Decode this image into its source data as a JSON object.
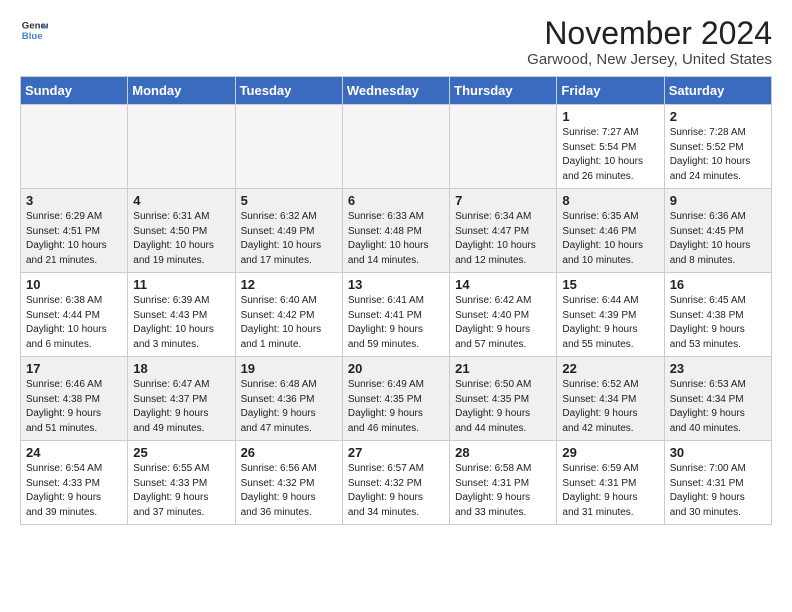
{
  "logo": {
    "line1": "General",
    "line2": "Blue"
  },
  "title": "November 2024",
  "location": "Garwood, New Jersey, United States",
  "weekdays": [
    "Sunday",
    "Monday",
    "Tuesday",
    "Wednesday",
    "Thursday",
    "Friday",
    "Saturday"
  ],
  "weeks": [
    [
      {
        "day": "",
        "info": ""
      },
      {
        "day": "",
        "info": ""
      },
      {
        "day": "",
        "info": ""
      },
      {
        "day": "",
        "info": ""
      },
      {
        "day": "",
        "info": ""
      },
      {
        "day": "1",
        "info": "Sunrise: 7:27 AM\nSunset: 5:54 PM\nDaylight: 10 hours\nand 26 minutes."
      },
      {
        "day": "2",
        "info": "Sunrise: 7:28 AM\nSunset: 5:52 PM\nDaylight: 10 hours\nand 24 minutes."
      }
    ],
    [
      {
        "day": "3",
        "info": "Sunrise: 6:29 AM\nSunset: 4:51 PM\nDaylight: 10 hours\nand 21 minutes."
      },
      {
        "day": "4",
        "info": "Sunrise: 6:31 AM\nSunset: 4:50 PM\nDaylight: 10 hours\nand 19 minutes."
      },
      {
        "day": "5",
        "info": "Sunrise: 6:32 AM\nSunset: 4:49 PM\nDaylight: 10 hours\nand 17 minutes."
      },
      {
        "day": "6",
        "info": "Sunrise: 6:33 AM\nSunset: 4:48 PM\nDaylight: 10 hours\nand 14 minutes."
      },
      {
        "day": "7",
        "info": "Sunrise: 6:34 AM\nSunset: 4:47 PM\nDaylight: 10 hours\nand 12 minutes."
      },
      {
        "day": "8",
        "info": "Sunrise: 6:35 AM\nSunset: 4:46 PM\nDaylight: 10 hours\nand 10 minutes."
      },
      {
        "day": "9",
        "info": "Sunrise: 6:36 AM\nSunset: 4:45 PM\nDaylight: 10 hours\nand 8 minutes."
      }
    ],
    [
      {
        "day": "10",
        "info": "Sunrise: 6:38 AM\nSunset: 4:44 PM\nDaylight: 10 hours\nand 6 minutes."
      },
      {
        "day": "11",
        "info": "Sunrise: 6:39 AM\nSunset: 4:43 PM\nDaylight: 10 hours\nand 3 minutes."
      },
      {
        "day": "12",
        "info": "Sunrise: 6:40 AM\nSunset: 4:42 PM\nDaylight: 10 hours\nand 1 minute."
      },
      {
        "day": "13",
        "info": "Sunrise: 6:41 AM\nSunset: 4:41 PM\nDaylight: 9 hours\nand 59 minutes."
      },
      {
        "day": "14",
        "info": "Sunrise: 6:42 AM\nSunset: 4:40 PM\nDaylight: 9 hours\nand 57 minutes."
      },
      {
        "day": "15",
        "info": "Sunrise: 6:44 AM\nSunset: 4:39 PM\nDaylight: 9 hours\nand 55 minutes."
      },
      {
        "day": "16",
        "info": "Sunrise: 6:45 AM\nSunset: 4:38 PM\nDaylight: 9 hours\nand 53 minutes."
      }
    ],
    [
      {
        "day": "17",
        "info": "Sunrise: 6:46 AM\nSunset: 4:38 PM\nDaylight: 9 hours\nand 51 minutes."
      },
      {
        "day": "18",
        "info": "Sunrise: 6:47 AM\nSunset: 4:37 PM\nDaylight: 9 hours\nand 49 minutes."
      },
      {
        "day": "19",
        "info": "Sunrise: 6:48 AM\nSunset: 4:36 PM\nDaylight: 9 hours\nand 47 minutes."
      },
      {
        "day": "20",
        "info": "Sunrise: 6:49 AM\nSunset: 4:35 PM\nDaylight: 9 hours\nand 46 minutes."
      },
      {
        "day": "21",
        "info": "Sunrise: 6:50 AM\nSunset: 4:35 PM\nDaylight: 9 hours\nand 44 minutes."
      },
      {
        "day": "22",
        "info": "Sunrise: 6:52 AM\nSunset: 4:34 PM\nDaylight: 9 hours\nand 42 minutes."
      },
      {
        "day": "23",
        "info": "Sunrise: 6:53 AM\nSunset: 4:34 PM\nDaylight: 9 hours\nand 40 minutes."
      }
    ],
    [
      {
        "day": "24",
        "info": "Sunrise: 6:54 AM\nSunset: 4:33 PM\nDaylight: 9 hours\nand 39 minutes."
      },
      {
        "day": "25",
        "info": "Sunrise: 6:55 AM\nSunset: 4:33 PM\nDaylight: 9 hours\nand 37 minutes."
      },
      {
        "day": "26",
        "info": "Sunrise: 6:56 AM\nSunset: 4:32 PM\nDaylight: 9 hours\nand 36 minutes."
      },
      {
        "day": "27",
        "info": "Sunrise: 6:57 AM\nSunset: 4:32 PM\nDaylight: 9 hours\nand 34 minutes."
      },
      {
        "day": "28",
        "info": "Sunrise: 6:58 AM\nSunset: 4:31 PM\nDaylight: 9 hours\nand 33 minutes."
      },
      {
        "day": "29",
        "info": "Sunrise: 6:59 AM\nSunset: 4:31 PM\nDaylight: 9 hours\nand 31 minutes."
      },
      {
        "day": "30",
        "info": "Sunrise: 7:00 AM\nSunset: 4:31 PM\nDaylight: 9 hours\nand 30 minutes."
      }
    ]
  ]
}
